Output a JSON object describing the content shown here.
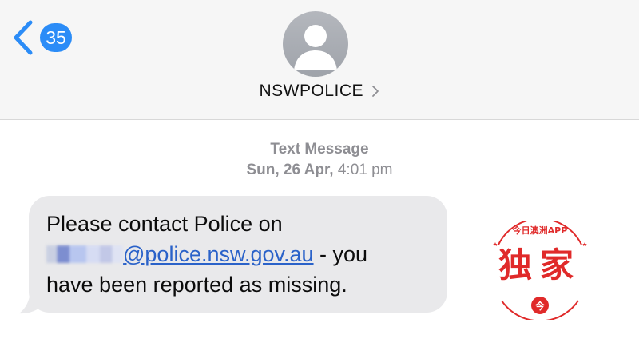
{
  "header": {
    "back_badge_count": "35",
    "contact_name": "NSWPOLICE",
    "icons": {
      "back": "chevron-left-icon",
      "avatar": "person-silhouette-icon",
      "contact_detail": "chevron-right-icon"
    },
    "colors": {
      "accent": "#2b8cf7",
      "header_bg": "#f6f6f6"
    }
  },
  "thread": {
    "service": "Text Message",
    "timestamp_day": "Sun, 26 Apr,",
    "timestamp_time": "4:01 pm"
  },
  "message": {
    "line1": "Please contact Police on",
    "email_domain": "@police.nsw.gov.au",
    "line2_rest": " - you",
    "line3": "have been reported as missing.",
    "bubble_color": "#e9e9eb",
    "link_color": "#2a62c9"
  },
  "watermark": {
    "top_text": "今日澳洲APP",
    "main_text": "独家",
    "bottom_char": "今",
    "color": "#e02a2a"
  }
}
